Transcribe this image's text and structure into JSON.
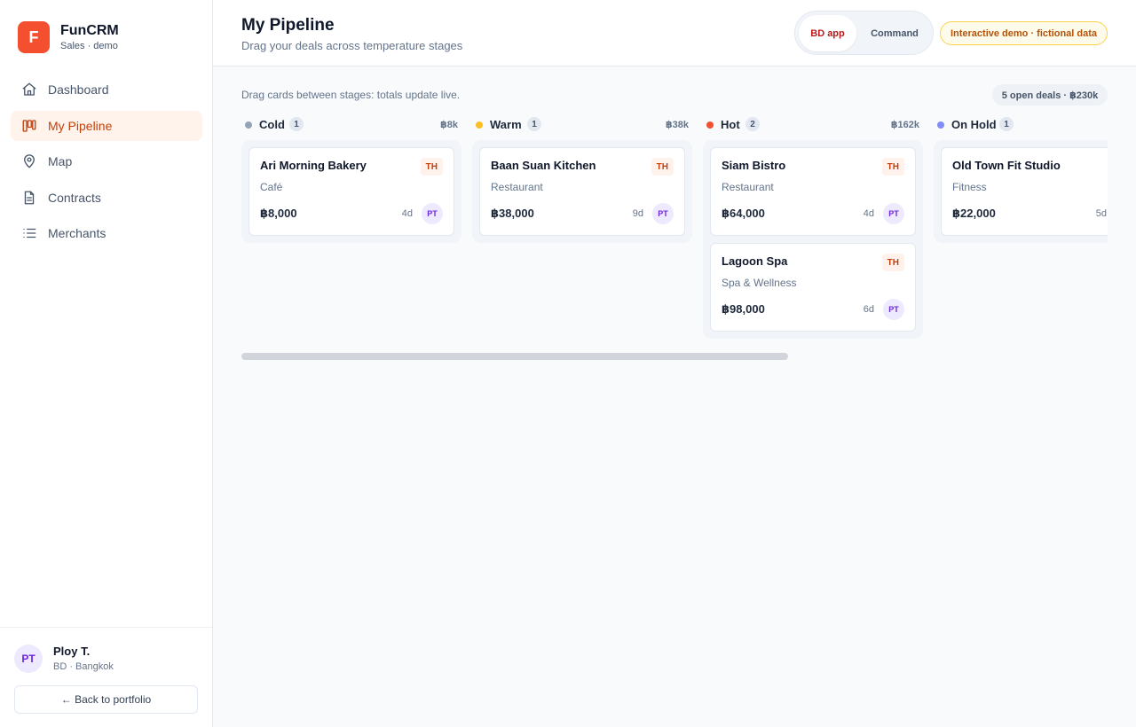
{
  "brand": {
    "logo_letter": "F",
    "name": "FunCRM",
    "subtitle": "Sales · demo",
    "color": "#f4502f"
  },
  "nav": [
    {
      "label": "Dashboard",
      "icon": "home-icon",
      "active": false
    },
    {
      "label": "My Pipeline",
      "icon": "kanban-icon",
      "active": true
    },
    {
      "label": "Map",
      "icon": "map-pin-icon",
      "active": false
    },
    {
      "label": "Contracts",
      "icon": "document-icon",
      "active": false
    },
    {
      "label": "Merchants",
      "icon": "list-icon",
      "active": false
    }
  ],
  "user": {
    "initials": "PT",
    "name": "Ploy T.",
    "role": "BD · Bangkok",
    "back_label": "← Back to portfolio"
  },
  "header": {
    "title": "My Pipeline",
    "subtitle": "Drag your deals across temperature stages",
    "toggle": {
      "active": "BD app",
      "inactive": "Command"
    },
    "demo_badge": "Interactive demo · fictional data"
  },
  "board": {
    "hint": "Drag cards between stages: totals update live.",
    "summary": "5 open deals · ฿230k",
    "columns": [
      {
        "name": "Cold",
        "count": "1",
        "total": "฿8k",
        "color": "#94a3b8",
        "cards": [
          {
            "name": "Ari Morning Bakery",
            "tag": "TH",
            "category": "Café",
            "amount": "฿8,000",
            "age": "4d",
            "owner": "PT"
          }
        ]
      },
      {
        "name": "Warm",
        "count": "1",
        "total": "฿38k",
        "color": "#fbbf24",
        "cards": [
          {
            "name": "Baan Suan Kitchen",
            "tag": "TH",
            "category": "Restaurant",
            "amount": "฿38,000",
            "age": "9d",
            "owner": "PT"
          }
        ]
      },
      {
        "name": "Hot",
        "count": "2",
        "total": "฿162k",
        "color": "#f4502f",
        "cards": [
          {
            "name": "Siam Bistro",
            "tag": "TH",
            "category": "Restaurant",
            "amount": "฿64,000",
            "age": "4d",
            "owner": "PT"
          },
          {
            "name": "Lagoon Spa",
            "tag": "TH",
            "category": "Spa & Wellness",
            "amount": "฿98,000",
            "age": "6d",
            "owner": "PT"
          }
        ]
      },
      {
        "name": "On Hold",
        "count": "1",
        "total": "",
        "color": "#818cf8",
        "cards": [
          {
            "name": "Old Town Fit Studio",
            "tag": "",
            "category": "Fitness",
            "amount": "฿22,000",
            "age": "5d",
            "owner": ""
          }
        ]
      }
    ]
  }
}
